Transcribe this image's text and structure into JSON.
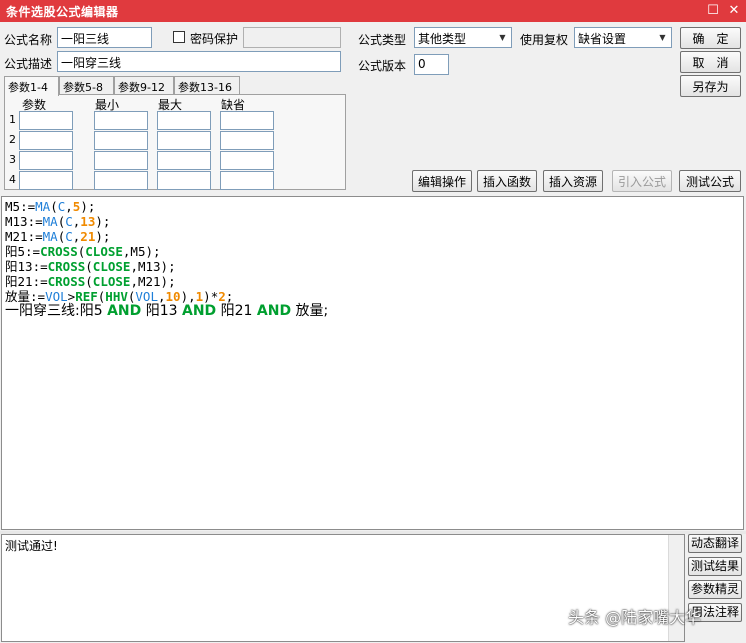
{
  "window": {
    "title": "条件选股公式编辑器",
    "maximize_glyph": "☐",
    "close_glyph": "✕"
  },
  "form": {
    "name_label": "公式名称",
    "name_value": "一阳三线",
    "password_label": "密码保护",
    "desc_label": "公式描述",
    "desc_value": "一阳穿三线",
    "type_label": "公式类型",
    "type_value": "其他类型",
    "fuquan_label": "使用复权",
    "fuquan_value": "缺省设置",
    "version_label": "公式版本",
    "version_value": "0"
  },
  "buttons": {
    "ok": "确　定",
    "cancel": "取　消",
    "saveas": "另存为",
    "edit_ops": "编辑操作",
    "insert_func": "插入函数",
    "insert_res": "插入资源",
    "import_formula": "引入公式",
    "test_formula": "测试公式"
  },
  "tabs": [
    "参数1-4",
    "参数5-8",
    "参数9-12",
    "参数13-16"
  ],
  "param_table": {
    "headers": [
      "参数",
      "最小",
      "最大",
      "缺省"
    ],
    "rows": [
      "1",
      "2",
      "3",
      "4"
    ]
  },
  "code_lines": [
    [
      [
        "var",
        "M5"
      ],
      [
        "op",
        ":="
      ],
      [
        "fn2",
        "MA"
      ],
      [
        "op",
        "("
      ],
      [
        "fn2",
        "C"
      ],
      [
        "op",
        ","
      ],
      [
        "num",
        "5"
      ],
      [
        "op",
        ");"
      ]
    ],
    [
      [
        "var",
        "M13"
      ],
      [
        "op",
        ":="
      ],
      [
        "fn2",
        "MA"
      ],
      [
        "op",
        "("
      ],
      [
        "fn2",
        "C"
      ],
      [
        "op",
        ","
      ],
      [
        "num",
        "13"
      ],
      [
        "op",
        ");"
      ]
    ],
    [
      [
        "var",
        "M21"
      ],
      [
        "op",
        ":="
      ],
      [
        "fn2",
        "MA"
      ],
      [
        "op",
        "("
      ],
      [
        "fn2",
        "C"
      ],
      [
        "op",
        ","
      ],
      [
        "num",
        "21"
      ],
      [
        "op",
        ");"
      ]
    ],
    [
      [
        "var",
        "阳5"
      ],
      [
        "op",
        ":="
      ],
      [
        "fn",
        "CROSS"
      ],
      [
        "op",
        "("
      ],
      [
        "fn",
        "CLOSE"
      ],
      [
        "op",
        ",M5);"
      ]
    ],
    [
      [
        "var",
        "阳13"
      ],
      [
        "op",
        ":="
      ],
      [
        "fn",
        "CROSS"
      ],
      [
        "op",
        "("
      ],
      [
        "fn",
        "CLOSE"
      ],
      [
        "op",
        ",M13);"
      ]
    ],
    [
      [
        "var",
        "阳21"
      ],
      [
        "op",
        ":="
      ],
      [
        "fn",
        "CROSS"
      ],
      [
        "op",
        "("
      ],
      [
        "fn",
        "CLOSE"
      ],
      [
        "op",
        ",M21);"
      ]
    ],
    [
      [
        "var",
        "放量"
      ],
      [
        "op",
        ":="
      ],
      [
        "fn2",
        "VOL"
      ],
      [
        "op",
        ">"
      ],
      [
        "fn",
        "REF"
      ],
      [
        "op",
        "("
      ],
      [
        "fn",
        "HHV"
      ],
      [
        "op",
        "("
      ],
      [
        "fn2",
        "VOL"
      ],
      [
        "op",
        ","
      ],
      [
        "num",
        "10"
      ],
      [
        "op",
        "),"
      ],
      [
        "num",
        "1"
      ],
      [
        "op",
        ")*"
      ],
      [
        "num",
        "2"
      ],
      [
        "op",
        ";"
      ]
    ],
    [
      [
        "var",
        "一阳穿三线:阳5 "
      ],
      [
        "kw",
        "AND"
      ],
      [
        "var",
        " 阳13 "
      ],
      [
        "kw",
        "AND"
      ],
      [
        "var",
        " 阳21 "
      ],
      [
        "kw",
        "AND"
      ],
      [
        "var",
        " 放量;"
      ]
    ]
  ],
  "output": {
    "text": "测试通过!"
  },
  "side_buttons": [
    "动态翻译",
    "测试结果",
    "参数精灵",
    "用法注释"
  ],
  "watermark": "头条 @陆家嘴大华"
}
